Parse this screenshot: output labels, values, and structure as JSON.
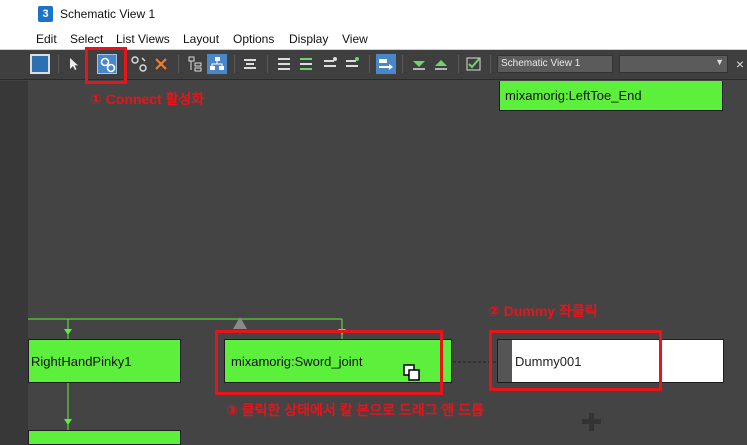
{
  "window": {
    "title": "Schematic View 1",
    "app_icon_glyph": "3"
  },
  "menu": {
    "items": [
      "Edit",
      "Select",
      "List Views",
      "Layout",
      "Options",
      "Display",
      "View"
    ]
  },
  "toolbar": {
    "view_name": "Schematic View 1",
    "close_glyph": "×",
    "dropdown_glyph": "▼"
  },
  "nodes": {
    "left_toe": "mixamorig:LeftToe_End",
    "right_hand_pinky": "RightHandPinky1",
    "sword_joint": "mixamorig:Sword_joint",
    "dummy": "Dummy001"
  },
  "annotations": {
    "step1": "① Connect 활성화",
    "step2": "② Dummy 좌클릭",
    "step3": "③ 클릭한 상태에서 칼 본으로 드래그 앤 드롭"
  },
  "colors": {
    "node_green": "#5cf03c",
    "annotation_red": "#e8141c",
    "canvas_bg": "#444444",
    "toolbar_bg": "#3f3f3f"
  }
}
